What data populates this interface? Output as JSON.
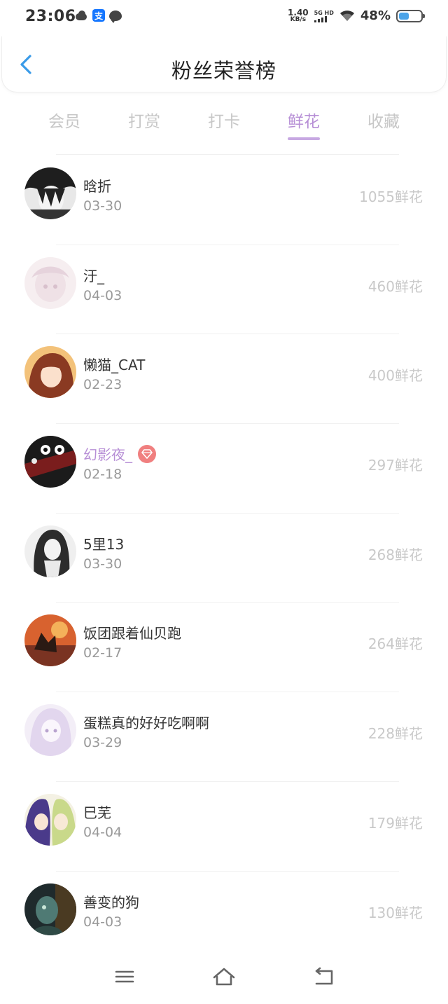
{
  "status_bar": {
    "time": "23:06",
    "net_speed_value": "1.40",
    "net_speed_unit": "KB/s",
    "signal_label": "5G HD",
    "battery_percent": "48%",
    "battery_level": 0.48,
    "alipay_glyph": "支",
    "icons": [
      "cloud-icon",
      "alipay-icon",
      "message-icon",
      "wifi-icon",
      "battery-icon"
    ]
  },
  "header": {
    "title": "粉丝荣誉榜",
    "back_icon": "chevron-left-icon"
  },
  "tabs": [
    {
      "label": "会员",
      "active": false
    },
    {
      "label": "打赏",
      "active": false
    },
    {
      "label": "打卡",
      "active": false
    },
    {
      "label": "鲜花",
      "active": true
    },
    {
      "label": "收藏",
      "active": false
    }
  ],
  "fans": [
    {
      "name": "晗折",
      "date": "03-30",
      "amount": "1055鲜花",
      "vip": false
    },
    {
      "name": "汙_",
      "date": "04-03",
      "amount": "460鲜花",
      "vip": false
    },
    {
      "name": "懒猫_CAT",
      "date": "02-23",
      "amount": "400鲜花",
      "vip": false
    },
    {
      "name": "幻影夜_",
      "date": "02-18",
      "amount": "297鲜花",
      "vip": true
    },
    {
      "name": "5里13",
      "date": "03-30",
      "amount": "268鲜花",
      "vip": false
    },
    {
      "name": "饭团跟着仙贝跑",
      "date": "02-17",
      "amount": "264鲜花",
      "vip": false
    },
    {
      "name": "蛋糕真的好好吃啊啊",
      "date": "03-29",
      "amount": "228鲜花",
      "vip": false
    },
    {
      "name": "巳芜",
      "date": "04-04",
      "amount": "179鲜花",
      "vip": false
    },
    {
      "name": "善变的狗",
      "date": "04-03",
      "amount": "130鲜花",
      "vip": false
    }
  ],
  "nav_bar": {
    "icons": [
      "menu-icon",
      "home-icon",
      "back-icon"
    ]
  },
  "colors": {
    "accent": "#b78fd6",
    "back_arrow": "#3a9be8",
    "vip_badge": "#f07f7f",
    "inactive_tab": "#c7c7c7",
    "amount": "#c9c9c9"
  }
}
